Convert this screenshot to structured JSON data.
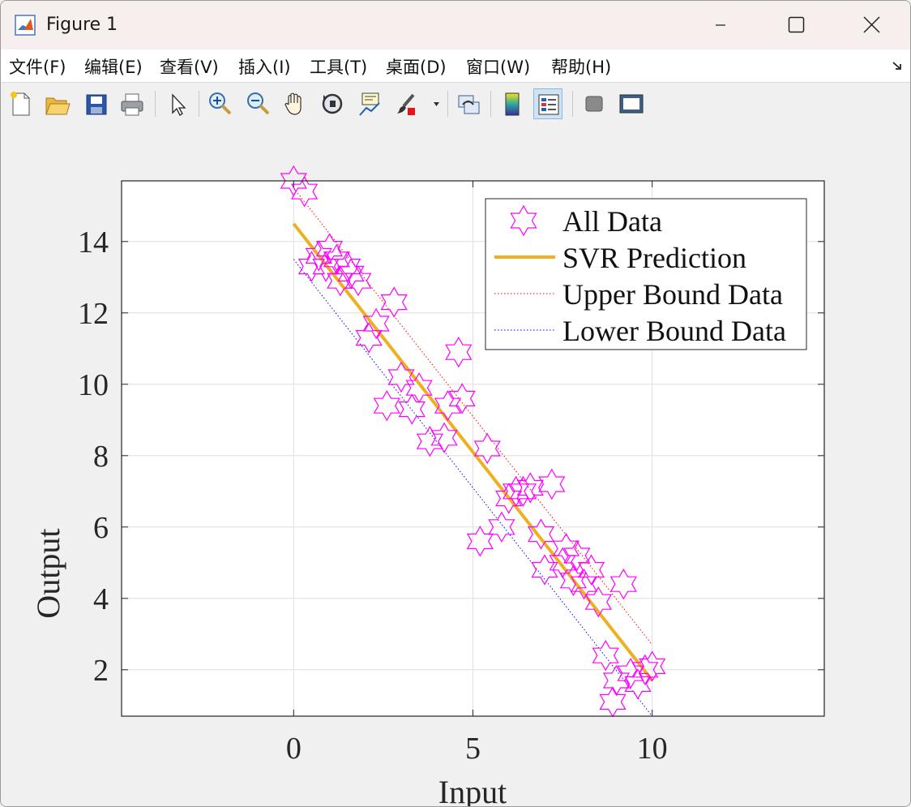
{
  "window": {
    "title": "Figure 1",
    "app_icon": "matlab-icon",
    "controls": [
      "minimize-icon",
      "maximize-icon",
      "close-icon"
    ]
  },
  "menubar": {
    "items": [
      "文件(F)",
      "编辑(E)",
      "查看(V)",
      "插入(I)",
      "工具(T)",
      "桌面(D)",
      "窗口(W)",
      "帮助(H)"
    ],
    "overflow_icon": "dock-arrow-icon"
  },
  "toolbar": {
    "tools": [
      {
        "name": "new-figure-icon"
      },
      {
        "name": "open-file-icon"
      },
      {
        "name": "save-icon"
      },
      {
        "name": "print-icon"
      },
      {
        "name": "edit-plot-pointer-icon"
      },
      {
        "name": "zoom-in-icon"
      },
      {
        "name": "zoom-out-icon"
      },
      {
        "name": "pan-hand-icon"
      },
      {
        "name": "rotate-3d-icon"
      },
      {
        "name": "data-cursor-icon"
      },
      {
        "name": "brush-icon"
      },
      {
        "name": "link-plot-icon"
      },
      {
        "name": "colorbar-icon"
      },
      {
        "name": "legend-icon",
        "active": true
      },
      {
        "name": "hide-plot-tools-icon"
      },
      {
        "name": "show-plot-tools-icon"
      }
    ]
  },
  "chart_data": {
    "type": "scatter",
    "xlabel": "Input",
    "ylabel": "Output",
    "xlim": [
      -4.8,
      14.8
    ],
    "ylim": [
      0.7,
      15.7
    ],
    "xticks": [
      0,
      5,
      10
    ],
    "yticks": [
      2,
      4,
      6,
      8,
      10,
      12,
      14
    ],
    "grid": true,
    "legend_position": "top-right",
    "colors": {
      "data": "#ff00ff",
      "svr": "#edb120",
      "upper": "#ff0000",
      "lower": "#0000ff"
    },
    "series": [
      {
        "name": "All Data",
        "style": "hexagram-marker",
        "x": [
          0.0,
          0.3,
          0.5,
          0.7,
          0.9,
          1.0,
          1.2,
          1.3,
          1.5,
          1.6,
          1.8,
          2.1,
          2.3,
          2.8,
          2.6,
          3.0,
          3.3,
          3.5,
          3.8,
          4.2,
          4.3,
          4.6,
          4.7,
          5.2,
          5.4,
          5.8,
          6.0,
          6.2,
          6.4,
          6.6,
          6.9,
          7.0,
          7.2,
          7.5,
          7.6,
          7.8,
          7.9,
          8.1,
          8.3,
          8.5,
          8.7,
          8.9,
          9.0,
          9.2,
          9.4,
          9.6,
          9.8,
          10.0
        ],
        "y": [
          15.7,
          15.4,
          13.3,
          13.6,
          13.3,
          13.8,
          13.5,
          12.9,
          13.3,
          13.1,
          12.9,
          11.3,
          11.7,
          12.3,
          9.4,
          10.2,
          9.3,
          9.9,
          8.4,
          8.5,
          9.4,
          10.9,
          9.6,
          5.6,
          8.2,
          6.0,
          6.8,
          7.0,
          7.0,
          7.1,
          5.8,
          4.8,
          7.2,
          5.0,
          5.4,
          4.5,
          5.2,
          4.4,
          4.8,
          3.9,
          2.4,
          1.1,
          1.7,
          4.4,
          1.9,
          1.6,
          2.0,
          2.1
        ]
      },
      {
        "name": "SVR Prediction",
        "style": "solid-line",
        "x": [
          0,
          10
        ],
        "y": [
          14.5,
          1.7
        ]
      },
      {
        "name": "Upper Bound Data",
        "style": "dotted-line",
        "x": [
          0,
          10
        ],
        "y": [
          15.5,
          2.7
        ]
      },
      {
        "name": "Lower Bound Data",
        "style": "dotted-line",
        "x": [
          0,
          10
        ],
        "y": [
          13.5,
          0.7
        ]
      }
    ]
  }
}
